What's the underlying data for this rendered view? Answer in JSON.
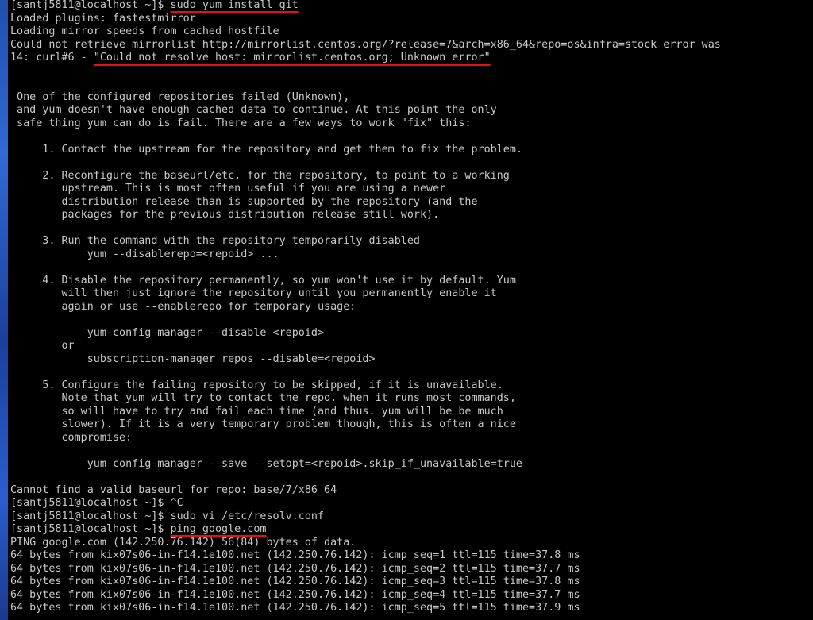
{
  "terminal": {
    "lines": [
      {
        "pre": "[santj5811@localhost ~]$ ",
        "mark": "sudo yum install git",
        "post": ""
      },
      {
        "pre": "Loaded plugins: fastestmirror",
        "mark": "",
        "post": ""
      },
      {
        "pre": "Loading mirror speeds from cached hostfile",
        "mark": "",
        "post": ""
      },
      {
        "pre": "Could not retrieve mirrorlist http://mirrorlist.centos.org/?release=7&arch=x86_64&repo=os&infra=stock error was",
        "mark": "",
        "post": ""
      },
      {
        "pre": "14: curl#6 - ",
        "mark": "\"Could not resolve host: mirrorlist.centos.org; Unknown error\"",
        "post": ""
      },
      {
        "pre": "",
        "mark": "",
        "post": ""
      },
      {
        "pre": "",
        "mark": "",
        "post": ""
      },
      {
        "pre": " One of the configured repositories failed (Unknown),",
        "mark": "",
        "post": ""
      },
      {
        "pre": " and yum doesn't have enough cached data to continue. At this point the only",
        "mark": "",
        "post": ""
      },
      {
        "pre": " safe thing yum can do is fail. There are a few ways to work \"fix\" this:",
        "mark": "",
        "post": ""
      },
      {
        "pre": "",
        "mark": "",
        "post": ""
      },
      {
        "pre": "     1. Contact the upstream for the repository and get them to fix the problem.",
        "mark": "",
        "post": ""
      },
      {
        "pre": "",
        "mark": "",
        "post": ""
      },
      {
        "pre": "     2. Reconfigure the baseurl/etc. for the repository, to point to a working",
        "mark": "",
        "post": ""
      },
      {
        "pre": "        upstream. This is most often useful if you are using a newer",
        "mark": "",
        "post": ""
      },
      {
        "pre": "        distribution release than is supported by the repository (and the",
        "mark": "",
        "post": ""
      },
      {
        "pre": "        packages for the previous distribution release still work).",
        "mark": "",
        "post": ""
      },
      {
        "pre": "",
        "mark": "",
        "post": ""
      },
      {
        "pre": "     3. Run the command with the repository temporarily disabled",
        "mark": "",
        "post": ""
      },
      {
        "pre": "            yum --disablerepo=<repoid> ...",
        "mark": "",
        "post": ""
      },
      {
        "pre": "",
        "mark": "",
        "post": ""
      },
      {
        "pre": "     4. Disable the repository permanently, so yum won't use it by default. Yum",
        "mark": "",
        "post": ""
      },
      {
        "pre": "        will then just ignore the repository until you permanently enable it",
        "mark": "",
        "post": ""
      },
      {
        "pre": "        again or use --enablerepo for temporary usage:",
        "mark": "",
        "post": ""
      },
      {
        "pre": "",
        "mark": "",
        "post": ""
      },
      {
        "pre": "            yum-config-manager --disable <repoid>",
        "mark": "",
        "post": ""
      },
      {
        "pre": "        or",
        "mark": "",
        "post": ""
      },
      {
        "pre": "            subscription-manager repos --disable=<repoid>",
        "mark": "",
        "post": ""
      },
      {
        "pre": "",
        "mark": "",
        "post": ""
      },
      {
        "pre": "     5. Configure the failing repository to be skipped, if it is unavailable.",
        "mark": "",
        "post": ""
      },
      {
        "pre": "        Note that yum will try to contact the repo. when it runs most commands,",
        "mark": "",
        "post": ""
      },
      {
        "pre": "        so will have to try and fail each time (and thus. yum will be be much",
        "mark": "",
        "post": ""
      },
      {
        "pre": "        slower). If it is a very temporary problem though, this is often a nice",
        "mark": "",
        "post": ""
      },
      {
        "pre": "        compromise:",
        "mark": "",
        "post": ""
      },
      {
        "pre": "",
        "mark": "",
        "post": ""
      },
      {
        "pre": "            yum-config-manager --save --setopt=<repoid>.skip_if_unavailable=true",
        "mark": "",
        "post": ""
      },
      {
        "pre": "",
        "mark": "",
        "post": ""
      },
      {
        "pre": "Cannot find a valid baseurl for repo: base/7/x86_64",
        "mark": "",
        "post": ""
      },
      {
        "pre": "[santj5811@localhost ~]$ ^C",
        "mark": "",
        "post": ""
      },
      {
        "pre": "[santj5811@localhost ~]$ sudo vi /etc/resolv.conf",
        "mark": "",
        "post": ""
      },
      {
        "pre": "[santj5811@localhost ~]$ ",
        "mark": "ping google.com",
        "post": ""
      },
      {
        "pre": "PING google.com (142.250.76.142) 56(84) bytes of data.",
        "mark": "",
        "post": ""
      },
      {
        "pre": "64 bytes from kix07s06-in-f14.1e100.net (142.250.76.142): icmp_seq=1 ttl=115 time=37.8 ms",
        "mark": "",
        "post": ""
      },
      {
        "pre": "64 bytes from kix07s06-in-f14.1e100.net (142.250.76.142): icmp_seq=2 ttl=115 time=37.7 ms",
        "mark": "",
        "post": ""
      },
      {
        "pre": "64 bytes from kix07s06-in-f14.1e100.net (142.250.76.142): icmp_seq=3 ttl=115 time=37.8 ms",
        "mark": "",
        "post": ""
      },
      {
        "pre": "64 bytes from kix07s06-in-f14.1e100.net (142.250.76.142): icmp_seq=4 ttl=115 time=37.7 ms",
        "mark": "",
        "post": ""
      },
      {
        "pre": "64 bytes from kix07s06-in-f14.1e100.net (142.250.76.142): icmp_seq=5 ttl=115 time=37.9 ms",
        "mark": "",
        "post": ""
      }
    ]
  },
  "colors": {
    "terminal_background": "#000000",
    "terminal_text": "#c8c8c8",
    "annotation_underline": "#e81010",
    "desktop_accent": "#2f6ad6"
  }
}
